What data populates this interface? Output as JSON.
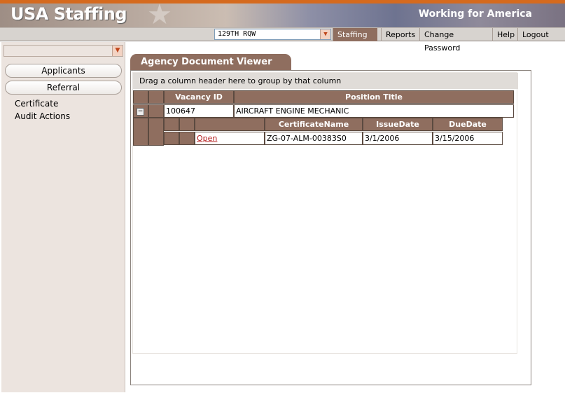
{
  "header": {
    "brand": "USA Staffing",
    "tagline": "Working for America"
  },
  "navbar": {
    "org_selected": "129TH RQW",
    "items": [
      "Staffing",
      "Reports",
      "Change Password",
      "Help",
      "Logout"
    ],
    "active": "Staffing"
  },
  "sidebar": {
    "select_value": "",
    "buttons": [
      "Applicants",
      "Referral"
    ],
    "links": [
      "Certificate",
      "Audit Actions"
    ]
  },
  "main": {
    "title": "Agency Document Viewer",
    "group_hint": "Drag a column header here to group by that column",
    "grid": {
      "columns": [
        "Vacancy ID",
        "Position Title"
      ],
      "rows": [
        {
          "vacancy_id": "100647",
          "position_title": "AIRCRAFT ENGINE MECHANIC",
          "child": {
            "columns": [
              "CertificateName",
              "IssueDate",
              "DueDate"
            ],
            "rows": [
              {
                "action": "Open",
                "certificate_name": "ZG-07-ALM-00383S0",
                "issue_date": "3/1/2006",
                "due_date": "3/15/2006"
              }
            ]
          }
        }
      ]
    }
  },
  "colors": {
    "accent_brown": "#8f6e5f",
    "sidebar_bg": "#ece4df",
    "link_red": "#b31b1b",
    "top_stripe": "#d56a1e"
  },
  "icons": {
    "dropdown": "chevron-down-icon",
    "collapse": "minus-icon"
  }
}
